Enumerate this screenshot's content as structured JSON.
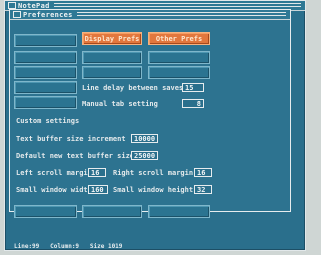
{
  "window": {
    "title": "NotePad",
    "prefs_title": "Preferences"
  },
  "tabs": {
    "left_blank": "",
    "display": "Display Prefs",
    "other": "Other Prefs"
  },
  "settings": {
    "line_delay_label": "Line delay between saves",
    "line_delay_value": "15",
    "manual_tab_label": "Manual tab setting",
    "manual_tab_value": "8",
    "custom_header": "Custom settings",
    "text_buffer_label": "Text buffer size increment",
    "text_buffer_value": "10000",
    "default_buffer_label": "Default new text buffer size",
    "default_buffer_value": "25000",
    "left_margin_label": "Left scroll margin",
    "left_margin_value": "16",
    "right_margin_label": "Right scroll margin",
    "right_margin_value": "16",
    "small_width_label": "Small window width",
    "small_width_value": "160",
    "small_height_label": "Small window height",
    "small_height_value": "32"
  },
  "status": {
    "line": "Line:99",
    "column": "Column:9",
    "size": "Size 1019"
  },
  "colors": {
    "background": "#2a6f8c",
    "accent": "#e2773d",
    "text": "#e3e9eb"
  }
}
